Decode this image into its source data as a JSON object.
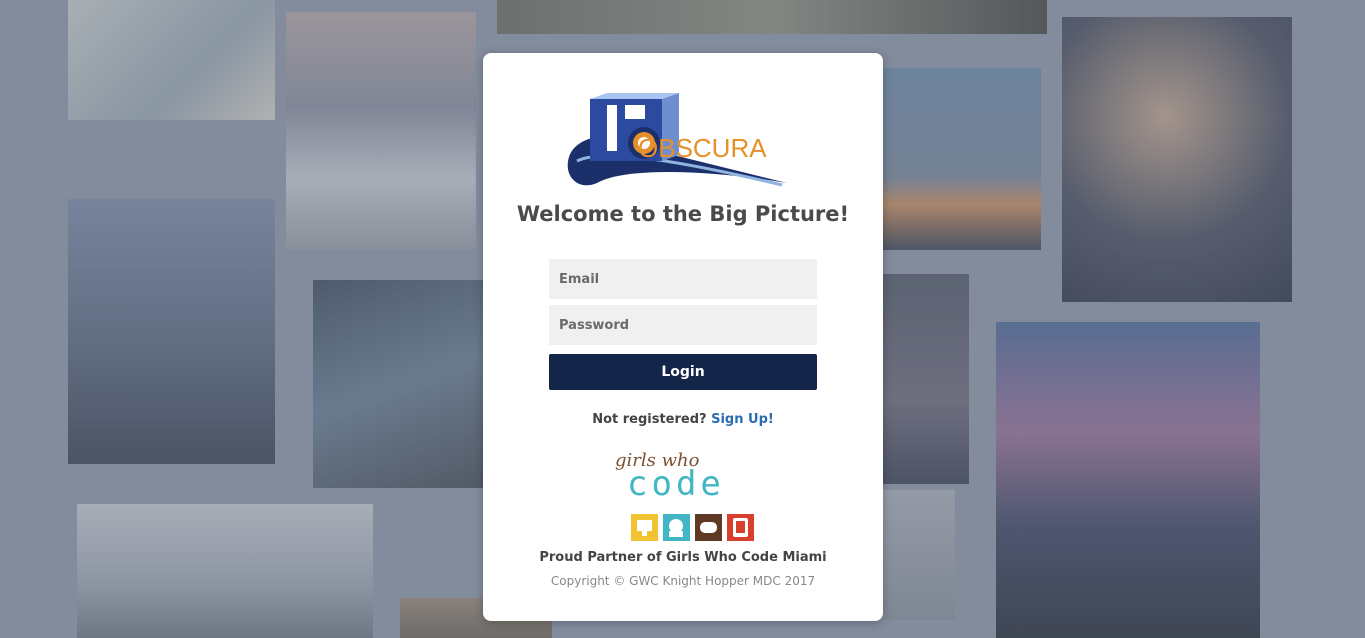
{
  "logo": {
    "text": "OBSCURA"
  },
  "heading": "Welcome to the Big Picture!",
  "form": {
    "email_placeholder": "Email",
    "password_placeholder": "Password",
    "login_label": "Login"
  },
  "register": {
    "prompt": "Not registered?",
    "link": "Sign Up!"
  },
  "partner": {
    "logo_script": "girls who",
    "logo_block": "code",
    "text": "Proud Partner of Girls Who Code Miami"
  },
  "copyright": "Copyright © GWC Knight Hopper MDC 2017",
  "colors": {
    "accent": "#14254a",
    "link": "#2b6cb0",
    "logo_orange": "#e6902a"
  }
}
